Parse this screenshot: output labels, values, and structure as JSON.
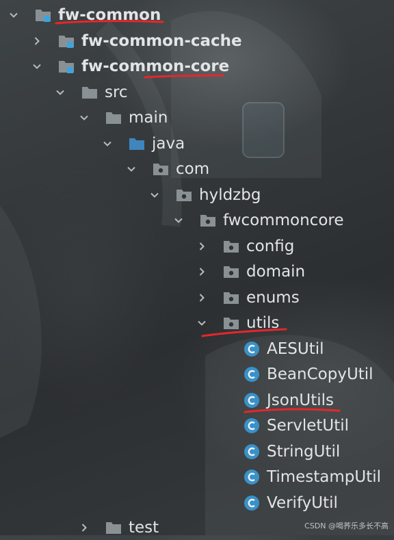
{
  "tree": {
    "root": {
      "label": "fw-common"
    },
    "module_cache": {
      "label": "fw-common-cache"
    },
    "module_core": {
      "label": "fw-common-core"
    },
    "src": {
      "label": "src"
    },
    "main": {
      "label": "main"
    },
    "java": {
      "label": "java"
    },
    "com": {
      "label": "com"
    },
    "hyldzbg": {
      "label": "hyldzbg"
    },
    "fwcommoncore": {
      "label": "fwcommoncore"
    },
    "config": {
      "label": "config"
    },
    "domain": {
      "label": "domain"
    },
    "enums": {
      "label": "enums"
    },
    "utils": {
      "label": "utils"
    },
    "classes": [
      {
        "label": "AESUtil"
      },
      {
        "label": "BeanCopyUtil"
      },
      {
        "label": "JsonUtils"
      },
      {
        "label": "ServletUtil"
      },
      {
        "label": "StringUtil"
      },
      {
        "label": "TimestampUtil"
      },
      {
        "label": "VerifyUtil"
      }
    ],
    "test": {
      "label": "test"
    }
  },
  "watermark": "CSDN @喝荞乐多长不高",
  "colors": {
    "folder": "#8a9195",
    "source_folder": "#3f86bd",
    "module_badge": "#3fa3dc",
    "class_icon": "#3a91c8",
    "annotation": "#e8262b",
    "text": "#e2e4e5"
  }
}
